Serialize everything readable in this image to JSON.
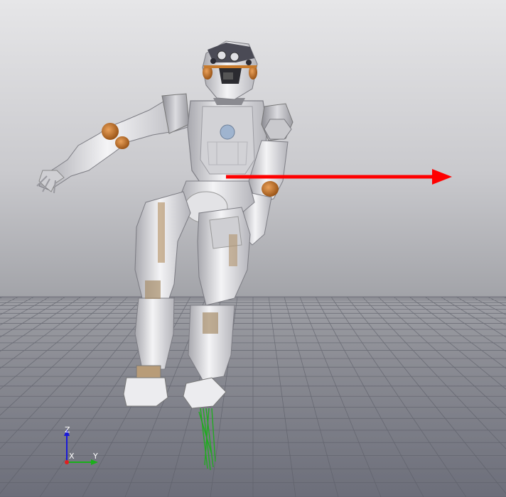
{
  "viewer": {
    "description_colors": {
      "sky_top": "#e6e6e8",
      "floor": "#7a7c85",
      "grid_line": "#5f616b",
      "push_arrow": "#ff0000",
      "contact_force": "#22aa22",
      "robot_metal": "#d9d9dc",
      "robot_joint": "#c77a2c"
    },
    "axes": {
      "z_label": "Z",
      "x_label": "X",
      "y_label": "Y",
      "z_color": "#1a1ad9",
      "y_color": "#1ab01a",
      "x_color": "#e02020"
    }
  }
}
